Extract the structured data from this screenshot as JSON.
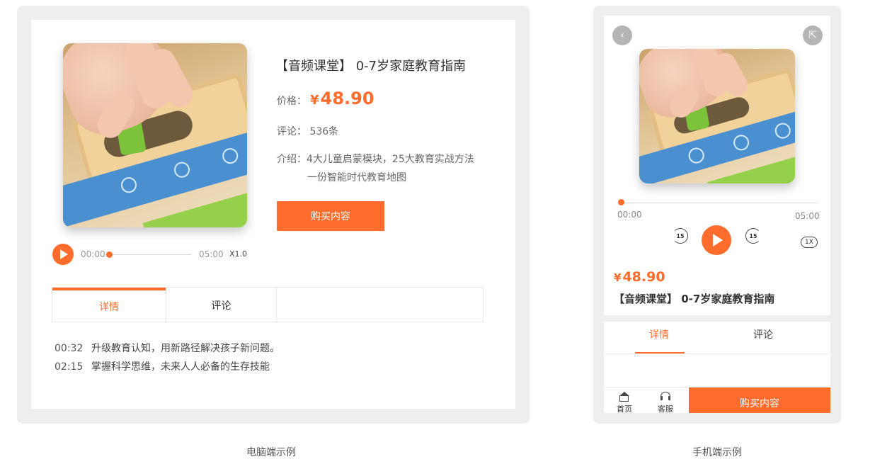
{
  "colors": {
    "accent": "#ff6c2c",
    "frame": "#eeeeee"
  },
  "desktop": {
    "title": "【音频课堂】 0-7岁家庭教育指南",
    "price_label": "价格：",
    "price_currency": "¥",
    "price_value": "48.90",
    "comment_label": "评论：",
    "comment_value": "536条",
    "intro_label": "介绍：",
    "intro_line1": "4大儿童启蒙模块，25大教育实战方法",
    "intro_line2": "一份智能时代教育地图",
    "buy_label": "购买内容",
    "player": {
      "current": "00:00",
      "total": "05:00",
      "speed": "X1.0",
      "progress": 0
    },
    "tabs": [
      {
        "label": "详情",
        "active": true
      },
      {
        "label": "评论",
        "active": false
      }
    ],
    "details": [
      {
        "time": "00:32",
        "text": "升级教育认知，用新路径解决孩子新问题。"
      },
      {
        "time": "02:15",
        "text": "掌握科学思维，未来人人必备的生存技能"
      }
    ],
    "caption": "电脑端示例"
  },
  "mobile": {
    "icons": {
      "back": "chevron-left-icon",
      "share": "share-icon"
    },
    "player": {
      "current": "00:00",
      "total": "05:00",
      "rewind": "15",
      "forward": "15",
      "speed": "1X",
      "progress": 0
    },
    "price_currency": "¥",
    "price_value": "48.90",
    "title": "【音频课堂】 0-7岁家庭教育指南",
    "tabs": [
      {
        "label": "详情",
        "active": true
      },
      {
        "label": "评论",
        "active": false
      }
    ],
    "bottom": {
      "home_label": "首页",
      "service_label": "客服",
      "buy_label": "购买内容"
    },
    "caption": "手机端示例"
  }
}
